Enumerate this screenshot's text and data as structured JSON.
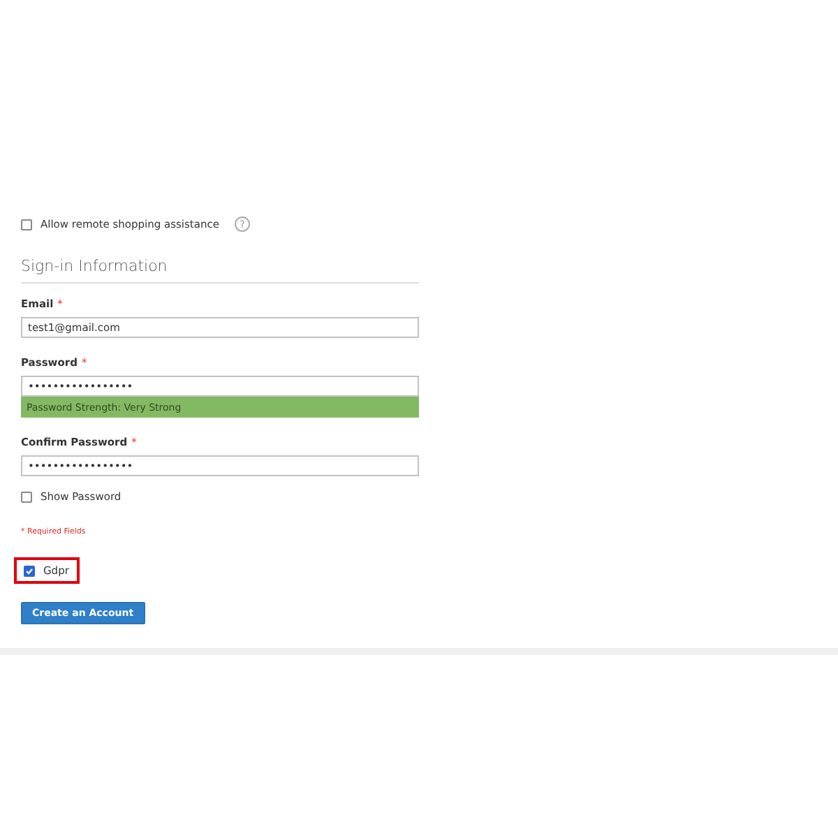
{
  "assistance": {
    "label": "Allow remote shopping assistance",
    "checked": false,
    "help_icon": "?"
  },
  "section_title": "Sign-in Information",
  "fields": [
    {
      "label": "Email",
      "required_mark": "*",
      "value": "test1@gmail.com"
    },
    {
      "label": "Password",
      "required_mark": "*",
      "value": "•••••••••••••••••",
      "strength": "Password Strength: Very Strong"
    },
    {
      "label": "Confirm Password",
      "required_mark": "*",
      "value": "•••••••••••••••••"
    }
  ],
  "show_password": {
    "label": "Show Password",
    "checked": false
  },
  "required_note": "* Required Fields",
  "gdpr": {
    "label": "Gdpr",
    "checked": true,
    "highlighted": true
  },
  "submit_button": "Create an Account"
}
